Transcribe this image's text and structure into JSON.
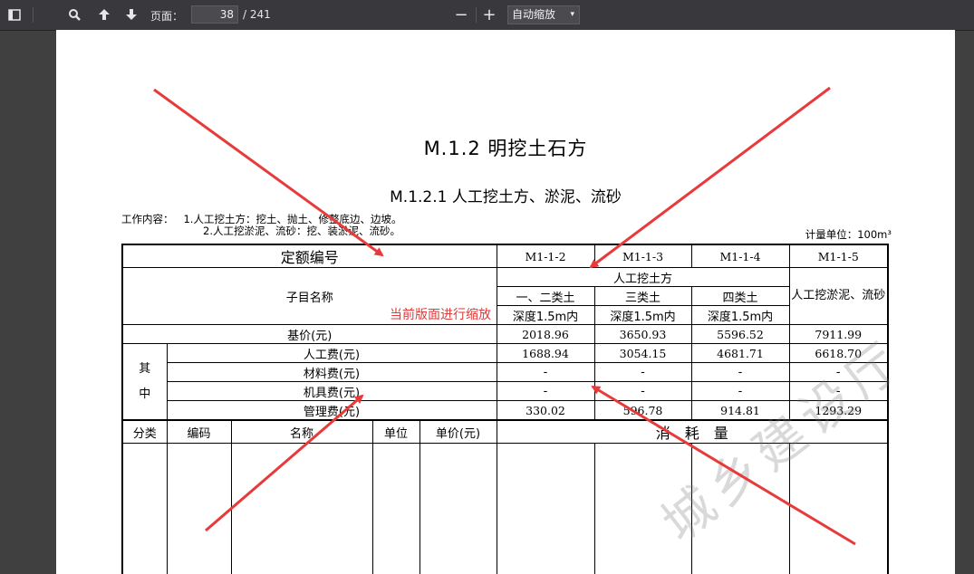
{
  "toolbar": {
    "page_label": "页面：",
    "current_page": "38",
    "total_pages": "/ 241",
    "zoom_value": "自动缩放",
    "zoom_out": "−",
    "zoom_in": "+"
  },
  "document": {
    "title": "M.1.2 明挖土石方",
    "subtitle": "M.1.2.1 人工挖土方、淤泥、流砂",
    "work_label": "工作内容：",
    "work_line1": "1.人工挖土方：挖土、抛土、修整底边、边坡。",
    "work_line2": "2.人工挖淤泥、流砂：挖、装淤泥、流砂。",
    "unit_text": "计量单位：100m³",
    "annotation": "当前版面进行缩放",
    "watermark": "城乡建设厅"
  },
  "table": {
    "quota_label": "定额编号",
    "codes": [
      "M1-1-2",
      "M1-1-3",
      "M1-1-4",
      "M1-1-5"
    ],
    "item_name_label": "子目名称",
    "group_header": "人工挖土方",
    "soil_types": [
      "一、二类土",
      "三类土",
      "四类土"
    ],
    "depths": [
      "深度1.5m内",
      "深度1.5m内",
      "深度1.5m内"
    ],
    "silt_header": "人工挖淤泥、流砂",
    "base_price_label": "基价(元)",
    "base_prices": [
      "2018.96",
      "3650.93",
      "5596.52",
      "7911.99"
    ],
    "among_label_1": "其",
    "among_label_2": "中",
    "labor_label": "人工费(元)",
    "labor": [
      "1688.94",
      "3054.15",
      "4681.71",
      "6618.70"
    ],
    "material_label": "材料费(元)",
    "material": [
      "-",
      "-",
      "-",
      "-"
    ],
    "machine_label": "机具费(元)",
    "machine": [
      "-",
      "-",
      "-",
      "-"
    ],
    "mgmt_label": "管理费(元)",
    "mgmt": [
      "330.02",
      "596.78",
      "914.81",
      "1293.29"
    ],
    "col_category": "分类",
    "col_code": "编码",
    "col_name": "名称",
    "col_unit": "单位",
    "col_price": "单价(元)",
    "col_consumption": "消　耗　量"
  },
  "colors": {
    "toolbar": "#38383d",
    "background": "#404040",
    "arrow": "#e83a3a"
  },
  "icons": [
    "sidebar-toggle-icon",
    "search-icon",
    "arrow-up-icon",
    "arrow-down-icon"
  ]
}
